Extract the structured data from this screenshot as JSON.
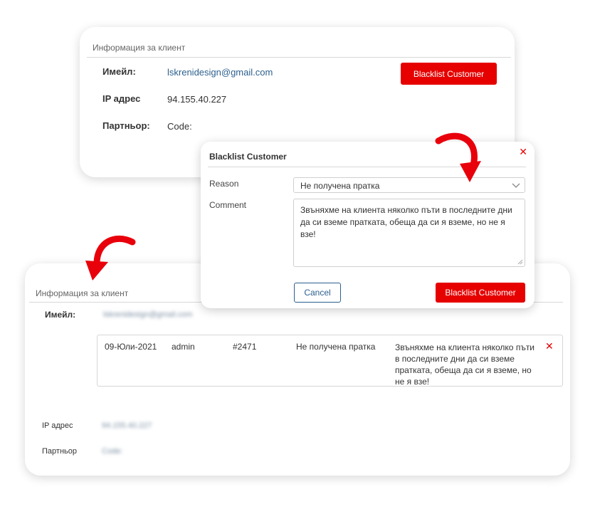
{
  "top_card": {
    "title": "Информация за клиент",
    "email_label": "Имейл:",
    "email_value": "lskrenidesign@gmail.com",
    "ip_label": "IP адрес",
    "ip_value": "94.155.40.227",
    "partner_label": "Партньор:",
    "partner_value": "Code:",
    "blacklist_button": "Blacklist Customer"
  },
  "modal": {
    "title": "Blacklist Customer",
    "close_icon": "close-icon",
    "reason_label": "Reason",
    "reason_value": "Не получена пратка",
    "comment_label": "Comment",
    "comment_value": "Звъняхме на клиента няколко пъти в последните дни да си вземе пратката, обеща да си я вземе, но не я взе!",
    "cancel_button": "Cancel",
    "submit_button": "Blacklist Customer"
  },
  "bottom_card": {
    "title": "Информация за клиент",
    "email_label": "Имейл:",
    "email_value": "lskrenidesign@gmail.com",
    "ip_label": "IP адрес",
    "ip_value": "94.155.40.227",
    "partner_label": "Партньор",
    "partner_value": "Code:",
    "entry": {
      "date": "09-Юли-2021",
      "user": "admin",
      "order": "#2471",
      "reason": "Не получена пратка",
      "comment": "Звъняхме на клиента няколко пъти в последните дни да си вземе пратката, обеща да си я вземе, но не я взе!"
    }
  },
  "colors": {
    "accent_red": "#e60000",
    "link_blue": "#2c5f8d",
    "arrow_red": "#e8000b"
  }
}
